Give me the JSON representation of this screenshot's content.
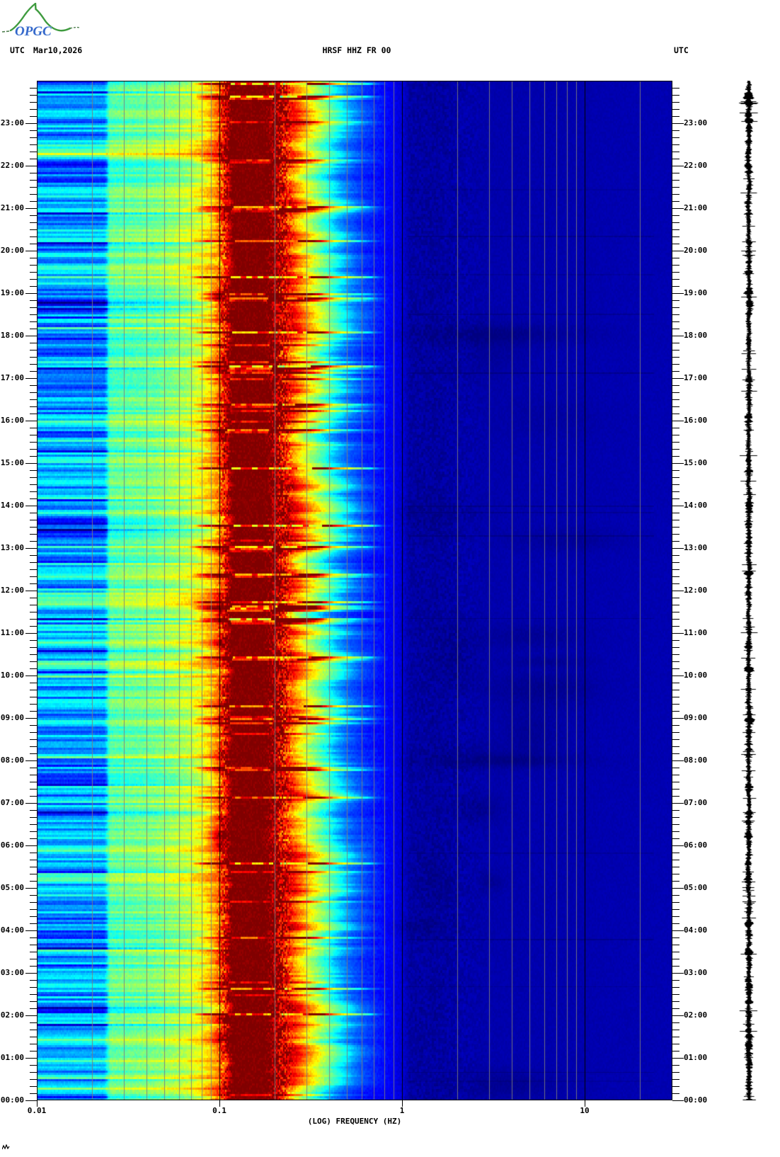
{
  "header": {
    "utc_left": "UTC",
    "date": "Mar10,2026",
    "station": "HRSF HHZ FR 00",
    "utc_right": "UTC"
  },
  "logo": {
    "text": "OPGC",
    "mountain_color": "#3f9b3f",
    "text_color": "#2e62c8"
  },
  "x_axis": {
    "title": "(LOG) FREQUENCY (HZ)",
    "scale": "log",
    "min_hz": 0.01,
    "max_hz": 30,
    "ticks": [
      {
        "label": "0.01",
        "hz": 0.01
      },
      {
        "label": "0.1",
        "hz": 0.1
      },
      {
        "label": "1",
        "hz": 1
      },
      {
        "label": "10",
        "hz": 10
      }
    ]
  },
  "y_axis": {
    "unit": "UTC",
    "direction": "bottom-to-top",
    "hours_span": 24,
    "minor_tick_minutes": 10,
    "hour_labels": [
      "23:00",
      "22:00",
      "21:00",
      "20:00",
      "19:00",
      "18:00",
      "17:00",
      "16:00",
      "15:00",
      "14:00",
      "13:00",
      "12:00",
      "11:00",
      "10:00",
      "09:00",
      "08:00",
      "07:00",
      "06:00",
      "05:00",
      "04:00",
      "03:00",
      "02:00",
      "01:00",
      "00:00"
    ]
  },
  "chart_data": {
    "type": "heatmap",
    "title": "HRSF HHZ FR 00",
    "subtitle": "24-hour seismic spectrogram, Mar10,2026 UTC",
    "xlabel": "(LOG) FREQUENCY (HZ)",
    "ylabel": "UTC",
    "x_range_hz": [
      0.01,
      30
    ],
    "y_range_hours": [
      0,
      24
    ],
    "grid": "on",
    "legend": "off",
    "colormap": "jet",
    "power_profile": {
      "log10_hz": [
        -2.0,
        -1.63,
        -1.6,
        -1.35,
        -1.18,
        -1.1,
        -1.04,
        -1.0,
        -0.97,
        -0.94,
        -0.74,
        -0.68,
        -0.62,
        -0.57,
        -0.53,
        -0.49,
        -0.45,
        -0.41,
        -0.36,
        -0.31,
        -0.26,
        -0.19,
        -0.12,
        -0.05,
        0.0,
        0.04,
        0.18,
        0.35,
        0.7,
        1.0,
        1.3,
        1.48
      ],
      "relative_power": [
        0.3,
        0.3,
        0.47,
        0.5,
        0.56,
        0.62,
        0.7,
        0.8,
        0.9,
        1.0,
        1.0,
        0.97,
        0.86,
        0.74,
        0.66,
        0.58,
        0.52,
        0.45,
        0.37,
        0.28,
        0.22,
        0.17,
        0.14,
        0.11,
        0.085,
        0.035,
        0.03,
        0.042,
        0.045,
        0.045,
        0.048,
        0.048
      ]
    },
    "bands": [
      {
        "freq_hz": [
          0.01,
          0.024
        ],
        "appearance": "light blue / cyan with strong horizontal stripes"
      },
      {
        "freq_hz": [
          0.024,
          0.09
        ],
        "appearance": "turquoise-green speckle with yellow streak rows"
      },
      {
        "freq_hz": [
          0.09,
          0.115
        ],
        "appearance": "red-orange flicker column"
      },
      {
        "freq_hz": [
          0.115,
          0.19
        ],
        "appearance": "saturated dark red (microseism peak)"
      },
      {
        "freq_hz": [
          0.19,
          0.25
        ],
        "appearance": "dark red / bright red vertical flicker"
      },
      {
        "freq_hz": [
          0.25,
          0.33
        ],
        "appearance": "orange-yellow ragged fringe"
      },
      {
        "freq_hz": [
          0.33,
          0.5
        ],
        "appearance": "green-cyan speckled fringe"
      },
      {
        "freq_hz": [
          0.5,
          1.0
        ],
        "appearance": "blue"
      },
      {
        "freq_hz": [
          1.0,
          1.7
        ],
        "appearance": "darkest navy mottled zone"
      },
      {
        "freq_hz": [
          1.7,
          30
        ],
        "appearance": "uniform navy with faint dark smudges and thin dark rows"
      }
    ],
    "transient_features": [
      {
        "type": "horizontal-streaks",
        "freq_hz": [
          0.05,
          0.35
        ],
        "description": "bright yellow/red rows at irregular times crossing the microseism band"
      },
      {
        "type": "dark-smudges",
        "freq_hz": [
          1.5,
          8
        ],
        "times_utc": [
          "18:00",
          "10:20",
          "08:00"
        ],
        "description": "slightly darker navy clouds"
      },
      {
        "type": "stripe-texture",
        "freq_hz": [
          0.01,
          0.09
        ],
        "description": "time-coherent horizontal banding"
      }
    ]
  },
  "right_margin": {
    "trace": "compressed 24-h seismogram drawn vertically",
    "color": "#000000"
  },
  "colors": {
    "background": "#ffffff",
    "plot_border": "#000000",
    "grid_minor": "#8a8a8a",
    "grid_major": "#000000",
    "saturated_band": "#8b0000",
    "quiet_background": "#0000a8",
    "text": "#000000"
  }
}
